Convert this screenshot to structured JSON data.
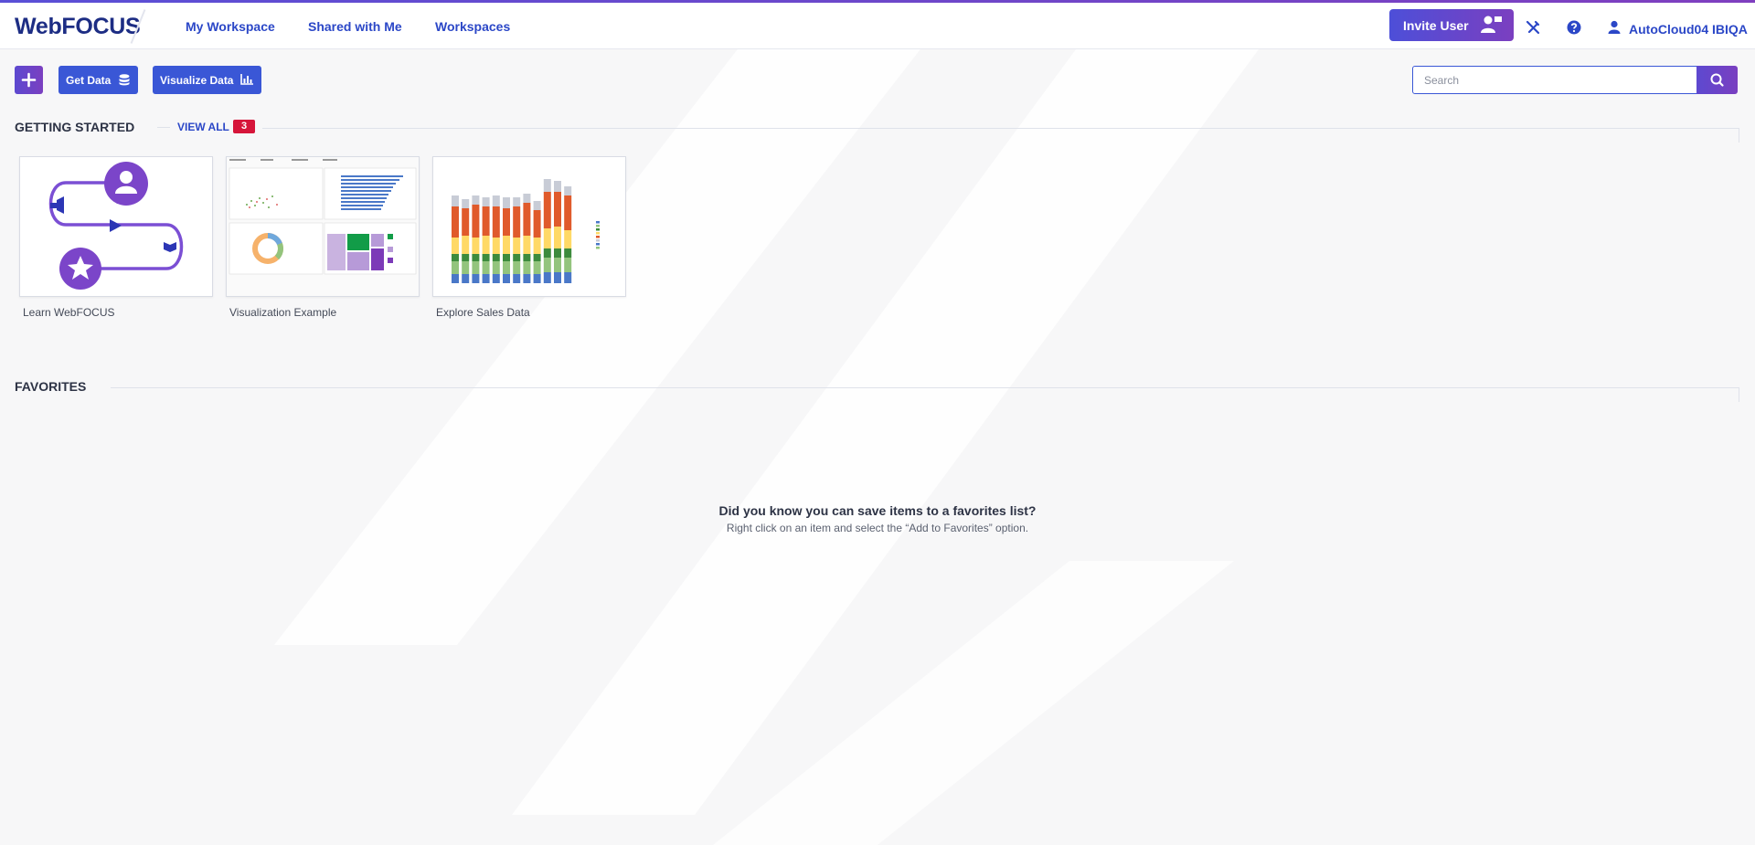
{
  "header": {
    "logo": "WebFOCUS",
    "nav": [
      "My Workspace",
      "Shared with Me",
      "Workspaces"
    ],
    "invite_label": "Invite User",
    "user_name": "AutoCloud04 IBIQA"
  },
  "toolbar": {
    "get_data_label": "Get Data",
    "visualize_data_label": "Visualize Data"
  },
  "search": {
    "placeholder": "Search"
  },
  "getting_started": {
    "title": "GETTING STARTED",
    "view_all_label": "VIEW ALL",
    "count": "3",
    "cards": [
      {
        "label": "Learn WebFOCUS"
      },
      {
        "label": "Visualization Example"
      },
      {
        "label": "Explore Sales Data"
      }
    ]
  },
  "favorites": {
    "title": "FAVORITES",
    "empty_title": "Did you know you can save items to a favorites list?",
    "empty_subtitle": "Right click on an item and select the “Add to Favorites” option."
  },
  "colors": {
    "brand_blue": "#3a57d6",
    "brand_purple": "#7a3fc0",
    "badge_red": "#d6153a",
    "navy": "#1d2d84"
  },
  "icons": {
    "new": "plus-icon",
    "get_data": "database-icon",
    "visualize": "bar-chart-icon",
    "search": "search-icon",
    "invite": "add-user-icon",
    "tools": "tools-icon",
    "help": "help-icon",
    "user": "user-icon"
  }
}
